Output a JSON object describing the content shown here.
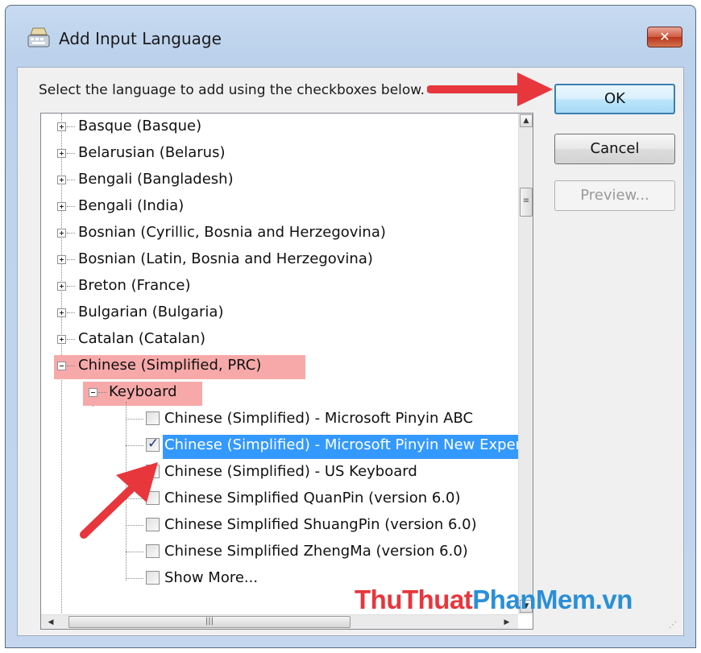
{
  "window": {
    "title": "Add Input Language",
    "close_label": "✕"
  },
  "prompt": "Select the language to add using the checkboxes below.",
  "buttons": {
    "ok": "OK",
    "cancel": "Cancel",
    "preview": "Preview..."
  },
  "tree": {
    "languages": [
      "Basque (Basque)",
      "Belarusian (Belarus)",
      "Bengali (Bangladesh)",
      "Bengali (India)",
      "Bosnian (Cyrillic, Bosnia and Herzegovina)",
      "Bosnian (Latin, Bosnia and Herzegovina)",
      "Breton (France)",
      "Bulgarian (Bulgaria)",
      "Catalan (Catalan)",
      "Chinese (Simplified, PRC)"
    ],
    "group": "Keyboard",
    "keyboards": [
      {
        "label": "Chinese (Simplified) - Microsoft Pinyin ABC",
        "checked": false
      },
      {
        "label": "Chinese (Simplified) - Microsoft Pinyin New Experience",
        "checked": true
      },
      {
        "label": "Chinese (Simplified) - US Keyboard",
        "checked": false
      },
      {
        "label": "Chinese Simplified QuanPin (version 6.0)",
        "checked": false
      },
      {
        "label": "Chinese Simplified ShuangPin (version 6.0)",
        "checked": false
      },
      {
        "label": "Chinese Simplified ZhengMa (version 6.0)",
        "checked": false
      },
      {
        "label": "Show More...",
        "checked": false
      }
    ]
  },
  "watermark": {
    "part1": "ThuThuat",
    "part2": "PhanMem",
    "part3": ".vn"
  },
  "colors": {
    "highlight_red": "#f7a9a9",
    "selection_blue": "#3399ff",
    "annotation_arrow": "#e8363d"
  }
}
